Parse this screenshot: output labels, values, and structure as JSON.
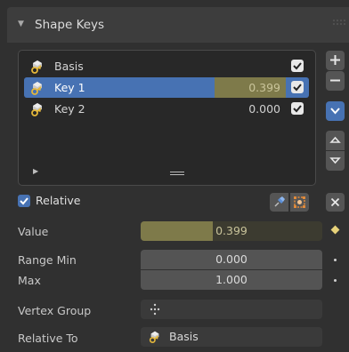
{
  "panel": {
    "title": "Shape Keys"
  },
  "shape_keys": [
    {
      "name": "Basis",
      "value": "",
      "enabled": true,
      "active": false
    },
    {
      "name": "Key 1",
      "value": "0.399",
      "enabled": true,
      "active": true
    },
    {
      "name": "Key 2",
      "value": "0.000",
      "enabled": true,
      "active": false
    }
  ],
  "relative": {
    "label": "Relative",
    "checked": true
  },
  "properties": {
    "value_label": "Value",
    "value": "0.399",
    "value_fraction": 0.399,
    "range_min_label": "Range Min",
    "range_min": "0.000",
    "max_label": "Max",
    "max": "1.000",
    "vertex_group_label": "Vertex Group",
    "vertex_group": "",
    "relative_to_label": "Relative To",
    "relative_to": "Basis"
  },
  "icons": {
    "key": "shape-key-icon",
    "add": "plus",
    "remove": "minus",
    "menu": "chevron-down",
    "move_up": "triangle-up",
    "move_down": "triangle-down",
    "pin": "pin-icon",
    "edit_mode": "edit-mode-icon",
    "clear": "x-icon",
    "group": "vertex-group-icon"
  },
  "colors": {
    "accent": "#4772b3",
    "slider_fill": "#7e7a4a",
    "keyframe": "#e7d27a"
  }
}
